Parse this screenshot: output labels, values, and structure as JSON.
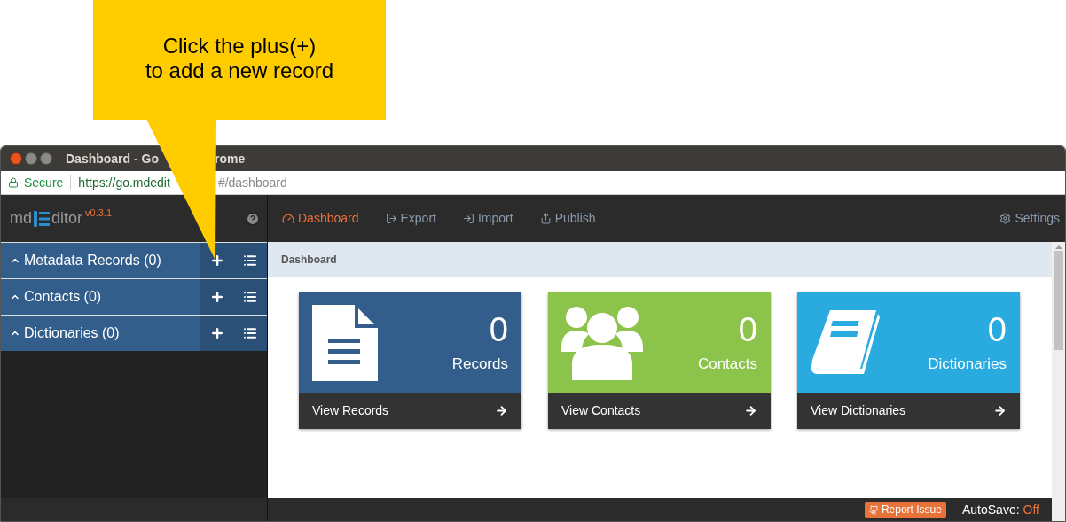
{
  "callout": {
    "lines": [
      "Click the plus(+)",
      "to add a new record"
    ]
  },
  "window": {
    "title_parts": [
      "Dashboard - Go",
      "rome"
    ]
  },
  "address_bar": {
    "secure_label": "Secure",
    "url_parts": [
      "https://go.mdedit",
      "#/dashboard"
    ]
  },
  "app": {
    "logo_left": "md",
    "logo_right": "ditor",
    "version": "v0.3.1"
  },
  "sidebar": {
    "items": [
      {
        "label": "Metadata Records (0)",
        "expanded": false
      },
      {
        "label": "Contacts (0)",
        "expanded": false
      },
      {
        "label": "Dictionaries (0)",
        "expanded": false
      }
    ]
  },
  "nav": {
    "items": [
      {
        "label": "Dashboard",
        "kind": "dashboard",
        "selected": true
      },
      {
        "label": "Export",
        "kind": "export",
        "selected": false
      },
      {
        "label": "Import",
        "kind": "import",
        "selected": false
      },
      {
        "label": "Publish",
        "kind": "publish",
        "selected": false
      }
    ],
    "settings": "Settings"
  },
  "breadcrumb": "Dashboard",
  "cards": [
    {
      "kind": "records",
      "count": "0",
      "label": "Records",
      "link": "View Records",
      "color": "#335d8a"
    },
    {
      "kind": "contacts",
      "count": "0",
      "label": "Contacts",
      "link": "View Contacts",
      "color": "#8cc34a"
    },
    {
      "kind": "dictionaries",
      "count": "0",
      "label": "Dictionaries",
      "link": "View Dictionaries",
      "color": "#29abe0"
    }
  ],
  "footer": {
    "report": "Report Issue",
    "autosave_label": "AutoSave:",
    "autosave_value": "Off"
  }
}
